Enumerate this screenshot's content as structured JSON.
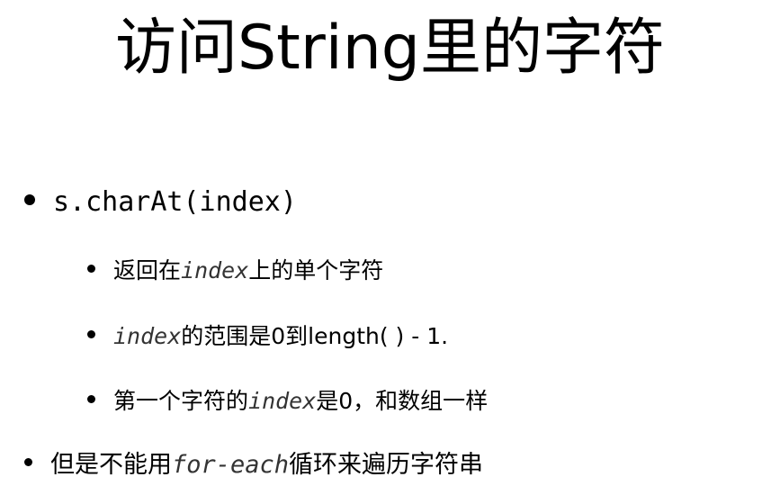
{
  "title": "访问String里的字符",
  "bullets": {
    "b1": {
      "code": "s.charAt(index)"
    },
    "b1_sub1": {
      "pre": "返回在",
      "code": "index",
      "post": "上的单个字符"
    },
    "b1_sub2": {
      "code": "index",
      "post": "的范围是0到length( ) - 1."
    },
    "b1_sub3": {
      "pre": "第一个字符的",
      "code": "index",
      "post": "是0，和数组一样"
    },
    "b2": {
      "pre": "但是不能用",
      "code": "for-each",
      "post": "循环来遍历字符串"
    }
  }
}
